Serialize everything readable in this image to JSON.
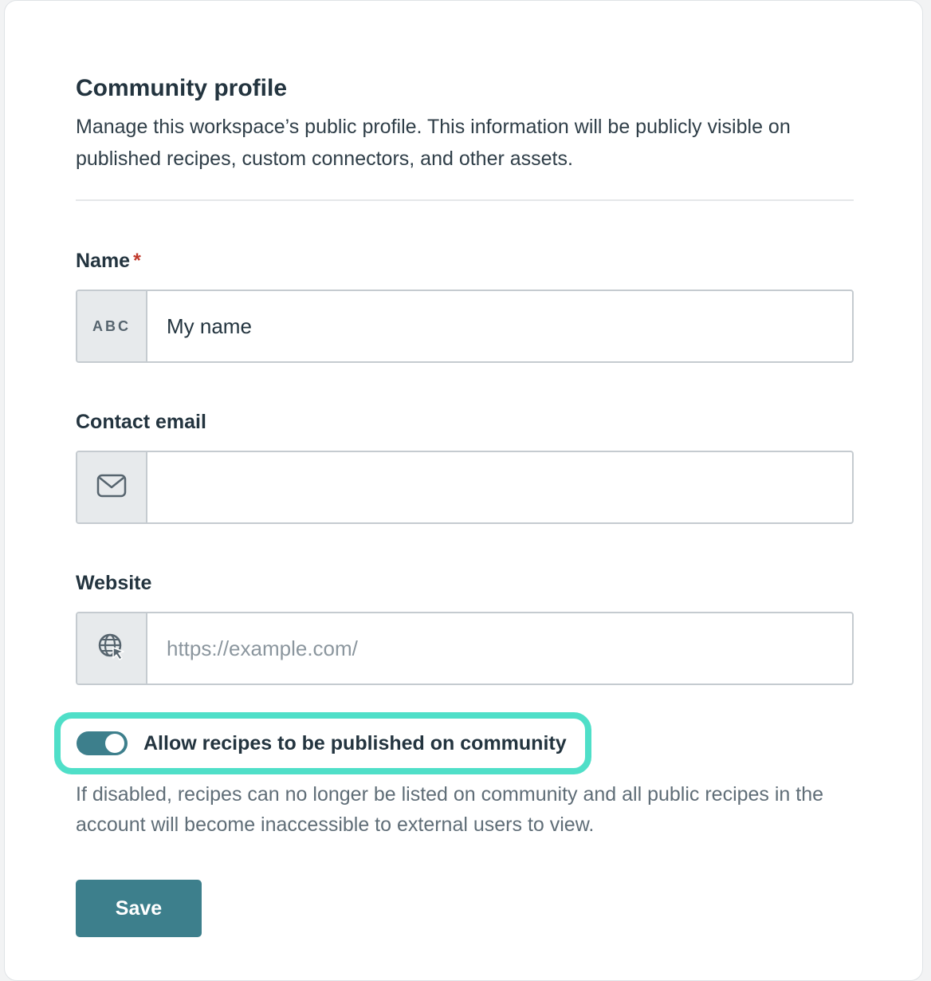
{
  "header": {
    "title": "Community profile",
    "description": "Manage this workspace’s public profile. This information will be publicly visible on published recipes, custom connectors, and other assets."
  },
  "fields": {
    "name": {
      "label": "Name",
      "required_marker": "*",
      "prefix_text": "ABC",
      "value": "My name",
      "placeholder": ""
    },
    "email": {
      "label": "Contact email",
      "prefix_icon": "mail-icon",
      "value": "",
      "placeholder": ""
    },
    "website": {
      "label": "Website",
      "prefix_icon": "globe-cursor-icon",
      "value": "",
      "placeholder": "https://example.com/"
    }
  },
  "community_toggle": {
    "label": "Allow recipes to be published on community",
    "enabled": true,
    "hint": "If disabled, recipes can no longer be listed on community and all public recipes in the account will become inaccessible to external users to view."
  },
  "actions": {
    "save_label": "Save"
  },
  "colors": {
    "accent": "#3d7f8c",
    "highlight": "#4fdfc8",
    "required": "#c0392b"
  }
}
